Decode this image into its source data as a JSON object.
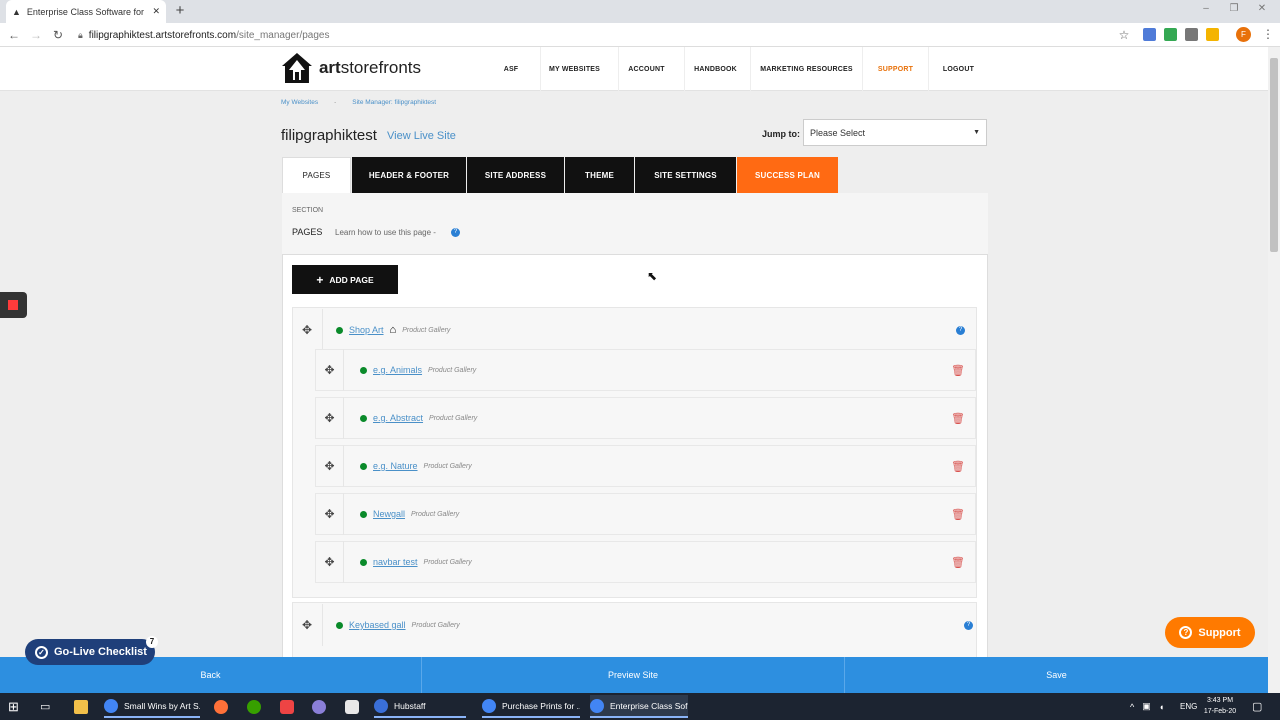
{
  "browser": {
    "tab_title": "Enterprise Class Software for Pri",
    "url_host": "filipgraphiktest.artstorefronts.com",
    "url_path": "/site_manager/pages",
    "profile_initial": "F"
  },
  "site": {
    "logo_bold": "art",
    "logo_rest": "storefronts",
    "nav": [
      "ASF",
      "MY WEBSITES",
      "ACCOUNT",
      "HANDBOOK",
      "MARKETING RESOURCES",
      "SUPPORT",
      "LOGOUT"
    ],
    "support_color": "#e8710a",
    "breadcrumb": [
      "My Websites",
      "-",
      "Site Manager: filipgraphiktest"
    ],
    "site_name": "filipgraphiktest",
    "view_live": "View Live Site",
    "jump_label": "Jump to:",
    "jump_value": "Please Select",
    "tabs": [
      "PAGES",
      "HEADER & FOOTER",
      "SITE ADDRESS",
      "THEME",
      "SITE SETTINGS",
      "SUCCESS PLAN"
    ],
    "section_label": "SECTION",
    "section_title": "PAGES",
    "section_help": "Learn how to use this page -",
    "add_page": "ADD PAGE",
    "pages": [
      {
        "title": "Shop Art",
        "type": "Product Gallery",
        "home": true
      },
      {
        "title": "e.g. Animals",
        "type": "Product Gallery"
      },
      {
        "title": "e.g. Abstract",
        "type": "Product Gallery"
      },
      {
        "title": "e.g. Nature",
        "type": "Product Gallery"
      },
      {
        "title": "Newgall",
        "type": "Product Gallery"
      },
      {
        "title": "navbar test",
        "type": "Product Gallery"
      },
      {
        "title": "Keybased gall",
        "type": "Product Gallery"
      }
    ],
    "bottom": [
      "Back",
      "Preview Site",
      "Save"
    ],
    "golive": "Go-Live Checklist",
    "golive_count": "7",
    "support_button": "Support"
  },
  "taskbar": {
    "items": [
      "Small Wins by Art S...",
      "Hubstaff",
      "Purchase Prints for ...",
      "Enterprise Class Sof..."
    ],
    "lang": "ENG",
    "time": "3:43 PM",
    "date": "17-Feb-20"
  }
}
